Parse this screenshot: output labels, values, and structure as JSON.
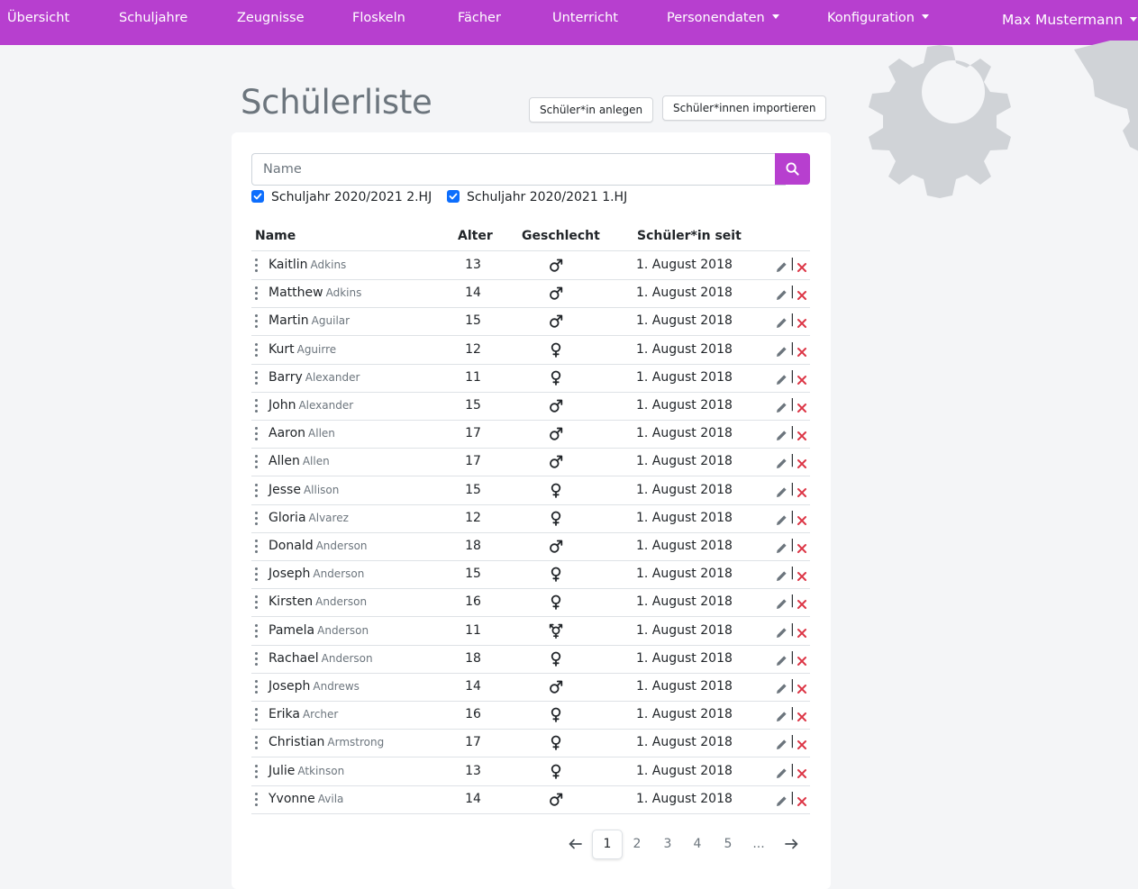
{
  "navbar": {
    "items": [
      {
        "label": "Übersicht"
      },
      {
        "label": "Schuljahre"
      },
      {
        "label": "Zeugnisse"
      },
      {
        "label": "Floskeln"
      },
      {
        "label": "Fächer"
      },
      {
        "label": "Unterricht"
      },
      {
        "label": "Personendaten"
      },
      {
        "label": "Konfiguration"
      }
    ],
    "user": "Max Mustermann"
  },
  "page": {
    "title": "Schülerliste",
    "create_label": "Schüler*in anlegen",
    "import_label": "Schüler*innen importieren"
  },
  "search": {
    "placeholder": "Name",
    "value": ""
  },
  "filters": [
    {
      "label": "Schuljahr 2020/2021 2.HJ",
      "checked": true
    },
    {
      "label": "Schuljahr 2020/2021 1.HJ",
      "checked": true
    }
  ],
  "table": {
    "headers": {
      "name": "Name",
      "age": "Alter",
      "gender": "Geschlecht",
      "since": "Schüler*in seit"
    },
    "rows": [
      {
        "first": "Kaitlin",
        "last": "Adkins",
        "age": "13",
        "gender": "male-icon",
        "since": "1. August 2018"
      },
      {
        "first": "Matthew",
        "last": "Adkins",
        "age": "14",
        "gender": "male-icon",
        "since": "1. August 2018"
      },
      {
        "first": "Martin",
        "last": "Aguilar",
        "age": "15",
        "gender": "male-icon",
        "since": "1. August 2018"
      },
      {
        "first": "Kurt",
        "last": "Aguirre",
        "age": "12",
        "gender": "female-icon",
        "since": "1. August 2018"
      },
      {
        "first": "Barry",
        "last": "Alexander",
        "age": "11",
        "gender": "female-icon",
        "since": "1. August 2018"
      },
      {
        "first": "John",
        "last": "Alexander",
        "age": "15",
        "gender": "male-icon",
        "since": "1. August 2018"
      },
      {
        "first": "Aaron",
        "last": "Allen",
        "age": "17",
        "gender": "male-icon",
        "since": "1. August 2018"
      },
      {
        "first": "Allen",
        "last": "Allen",
        "age": "17",
        "gender": "male-icon",
        "since": "1. August 2018"
      },
      {
        "first": "Jesse",
        "last": "Allison",
        "age": "15",
        "gender": "female-icon",
        "since": "1. August 2018"
      },
      {
        "first": "Gloria",
        "last": "Alvarez",
        "age": "12",
        "gender": "female-icon",
        "since": "1. August 2018"
      },
      {
        "first": "Donald",
        "last": "Anderson",
        "age": "18",
        "gender": "male-icon",
        "since": "1. August 2018"
      },
      {
        "first": "Joseph",
        "last": "Anderson",
        "age": "15",
        "gender": "female-icon",
        "since": "1. August 2018"
      },
      {
        "first": "Kirsten",
        "last": "Anderson",
        "age": "16",
        "gender": "female-icon",
        "since": "1. August 2018"
      },
      {
        "first": "Pamela",
        "last": "Anderson",
        "age": "11",
        "gender": "transgender-icon",
        "since": "1. August 2018"
      },
      {
        "first": "Rachael",
        "last": "Anderson",
        "age": "18",
        "gender": "female-icon",
        "since": "1. August 2018"
      },
      {
        "first": "Joseph",
        "last": "Andrews",
        "age": "14",
        "gender": "male-icon",
        "since": "1. August 2018"
      },
      {
        "first": "Erika",
        "last": "Archer",
        "age": "16",
        "gender": "female-icon",
        "since": "1. August 2018"
      },
      {
        "first": "Christian",
        "last": "Armstrong",
        "age": "17",
        "gender": "female-icon",
        "since": "1. August 2018"
      },
      {
        "first": "Julie",
        "last": "Atkinson",
        "age": "13",
        "gender": "female-icon",
        "since": "1. August 2018"
      },
      {
        "first": "Yvonne",
        "last": "Avila",
        "age": "14",
        "gender": "male-icon",
        "since": "1. August 2018"
      }
    ],
    "separator": "|"
  },
  "pagination": {
    "pages": [
      "1",
      "2",
      "3",
      "4",
      "5",
      "..."
    ],
    "current": "1"
  },
  "colors": {
    "brand": "#b73fcf",
    "checkbox": "#0d6efd",
    "delete": "#dc3545"
  }
}
